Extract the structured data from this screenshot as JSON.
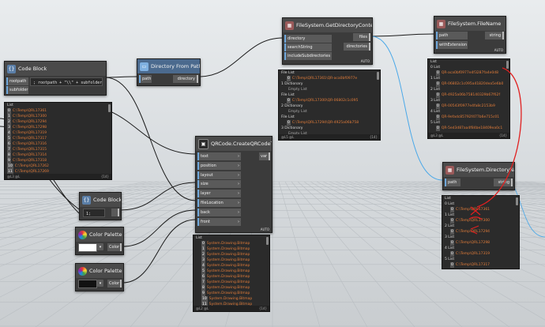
{
  "nodes": {
    "code_block_1": {
      "title": "Code Block",
      "inputs": [
        "rootpath",
        "subfolder"
      ],
      "code": "; rootpath + \"\\\\\" + subfolder;"
    },
    "dir_from_path": {
      "title": "Directory From Path",
      "input": "path",
      "output": "directory"
    },
    "get_dir_contents": {
      "title": "FileSystem.GetDirectoryContents",
      "inputs": [
        "directory",
        "searchString",
        "includeSubdirectories"
      ],
      "outputs": [
        "files",
        "directories"
      ],
      "auto": "AUTO"
    },
    "file_name": {
      "title": "FileSystem.FileName",
      "inputs": [
        "path",
        "withExtension"
      ],
      "output": "string",
      "auto": "AUTO"
    },
    "dir_name": {
      "title": "FileSystem.DirectoryName",
      "input": "path",
      "output": "string"
    },
    "qrcode": {
      "title": "QRCode.CreateQRCodeText",
      "inputs": [
        "text",
        "position",
        "layout",
        "size",
        "layer",
        "fileLocation",
        "back",
        "front"
      ],
      "output": "var",
      "auto": "AUTO"
    },
    "code_block_2": {
      "title": "Code Block",
      "code": "1;"
    },
    "color_palette_1": {
      "title": "Color Palette",
      "output": "Color",
      "swatch": "#ffffff"
    },
    "color_palette_2": {
      "title": "Color Palette",
      "output": "Color",
      "swatch": "#111111"
    }
  },
  "previews": {
    "code_list": {
      "header": "List",
      "rows": [
        {
          "i": "0",
          "v": "C:\\Temp\\QRL17361"
        },
        {
          "i": "1",
          "v": "C:\\Temp\\QRL17300"
        },
        {
          "i": "2",
          "v": "C:\\Temp\\QRL17294"
        },
        {
          "i": "3",
          "v": "C:\\Temp\\QRL17298"
        },
        {
          "i": "4",
          "v": "C:\\Temp\\QRL17319"
        },
        {
          "i": "5",
          "v": "C:\\Temp\\QRL17317"
        },
        {
          "i": "6",
          "v": "C:\\Temp\\QRL17316"
        },
        {
          "i": "7",
          "v": "C:\\Temp\\QRL17315"
        },
        {
          "i": "8",
          "v": "C:\\Temp\\QRL17314"
        },
        {
          "i": "9",
          "v": "C:\\Temp\\QRL17318"
        },
        {
          "i": "10",
          "v": "C:\\Temp\\QRL17262"
        },
        {
          "i": "11",
          "v": "C:\\Temp\\QRL17269"
        }
      ],
      "foot_left": "@L3 @L",
      "foot_right": "{14}"
    },
    "dir_contents": {
      "rows": [
        {
          "t": "File List",
          "k": "h"
        },
        {
          "i": "0",
          "v": "C:\\Temp\\QRL17361\\QR-aca0bf0977e",
          "k": "v"
        },
        {
          "t": "1 Dictionary",
          "k": "h"
        },
        {
          "t": "Empty List",
          "k": "s"
        },
        {
          "t": "File List",
          "k": "h"
        },
        {
          "i": "0",
          "v": "C:\\Temp\\QRL17300\\QR-06802c1c095",
          "k": "v"
        },
        {
          "t": "2 Dictionary",
          "k": "h"
        },
        {
          "t": "Empty List",
          "k": "s"
        },
        {
          "t": "File List",
          "k": "h"
        },
        {
          "i": "0",
          "v": "C:\\Temp\\QRL17294\\QR-4925a06b758",
          "k": "v"
        },
        {
          "t": "3 Dictionary",
          "k": "h"
        },
        {
          "t": "Empty List",
          "k": "s"
        },
        {
          "t": "File List",
          "k": "h"
        },
        {
          "i": "0",
          "v": "C:\\Temp\\QRL17298\\QR-00543f0977e",
          "k": "v"
        }
      ],
      "foot_left": "@L5 @L",
      "foot_right": "{14}"
    },
    "file_name_list": {
      "rows": [
        {
          "t": "List",
          "k": "h"
        },
        {
          "t": "0 List",
          "k": "h"
        },
        {
          "i": "0",
          "v": "QR-aca0bf0977e4f3287fa4e0d8",
          "k": "v"
        },
        {
          "t": "1 List",
          "k": "h"
        },
        {
          "i": "0",
          "v": "QR-06802c1c095a41820dea5e6b0",
          "k": "v"
        },
        {
          "t": "2 List",
          "k": "h"
        },
        {
          "i": "0",
          "v": "QR-4925a06b758140329b67f62f",
          "k": "v"
        },
        {
          "t": "3 List",
          "k": "h"
        },
        {
          "i": "0",
          "v": "QR-00543f0977e4fa8c2153b9",
          "k": "v"
        },
        {
          "t": "4 List",
          "k": "h"
        },
        {
          "i": "0",
          "v": "QR-9efadc85792f477b6e715c01",
          "k": "v"
        },
        {
          "t": "5 List",
          "k": "h"
        },
        {
          "i": "0",
          "v": "QR-5ed3d87aa4f84be18409ea0c1",
          "k": "v"
        }
      ],
      "foot_left": "@L3 @L",
      "foot_right": "{14}"
    },
    "dir_name_list": {
      "rows": [
        {
          "t": "List",
          "k": "h"
        },
        {
          "t": "0 List",
          "k": "h"
        },
        {
          "i": "0",
          "v": "C:\\Temp\\QRL17361",
          "k": "v"
        },
        {
          "t": "1 List",
          "k": "h"
        },
        {
          "i": "0",
          "v": "C:\\Temp\\QRL17300",
          "k": "v"
        },
        {
          "t": "2 List",
          "k": "h"
        },
        {
          "i": "0",
          "v": "C:\\Temp\\QRL17294",
          "k": "v"
        },
        {
          "t": "3 List",
          "k": "h"
        },
        {
          "i": "0",
          "v": "C:\\Temp\\QRL17298",
          "k": "v"
        },
        {
          "t": "4 List",
          "k": "h"
        },
        {
          "i": "0",
          "v": "C:\\Temp\\QRL17319",
          "k": "v"
        },
        {
          "t": "5 List",
          "k": "h"
        },
        {
          "i": "0",
          "v": "C:\\Temp\\QRL17317",
          "k": "v"
        }
      ],
      "foot_left": "@L3 @L",
      "foot_right": "{14}"
    },
    "qrcode_list": {
      "header": "List",
      "rows": [
        {
          "i": "0",
          "v": "System.Drawing.Bitmap"
        },
        {
          "i": "1",
          "v": "System.Drawing.Bitmap"
        },
        {
          "i": "2",
          "v": "System.Drawing.Bitmap"
        },
        {
          "i": "3",
          "v": "System.Drawing.Bitmap"
        },
        {
          "i": "4",
          "v": "System.Drawing.Bitmap"
        },
        {
          "i": "5",
          "v": "System.Drawing.Bitmap"
        },
        {
          "i": "6",
          "v": "System.Drawing.Bitmap"
        },
        {
          "i": "7",
          "v": "System.Drawing.Bitmap"
        },
        {
          "i": "8",
          "v": "System.Drawing.Bitmap"
        },
        {
          "i": "9",
          "v": "System.Drawing.Bitmap"
        },
        {
          "i": "10",
          "v": "System.Drawing.Bitmap"
        },
        {
          "i": "11",
          "v": "System.Drawing.Bitmap"
        }
      ],
      "foot_left": "@L2 @L",
      "foot_right": "{14}"
    }
  },
  "colors": {
    "wire": "#1a1a1a",
    "wire_selected": "#4aa8e8",
    "annotation": "#e02020",
    "port_accent": "#6fa8dc"
  }
}
